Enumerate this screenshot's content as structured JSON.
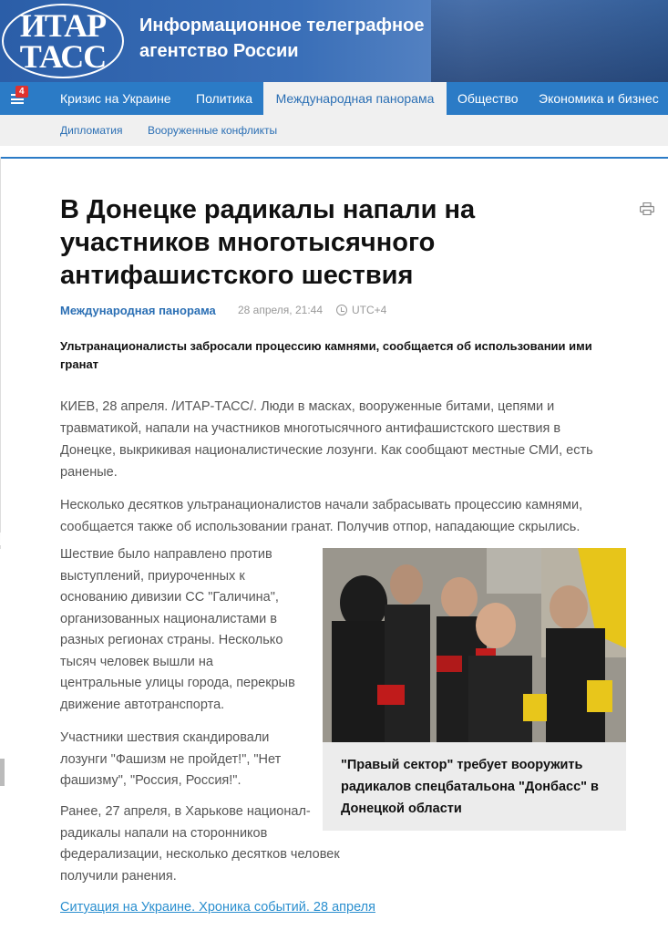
{
  "header": {
    "logo_line1": "ИТАР",
    "logo_line2": "ТАСС",
    "agency_line1": "Информационное телеграфное",
    "agency_line2": "агентство России"
  },
  "nav": {
    "badge": "4",
    "items": [
      {
        "label": "Кризис на Украине"
      },
      {
        "label": "Политика"
      },
      {
        "label": "Международная панорама"
      },
      {
        "label": "Общество"
      },
      {
        "label": "Экономика и бизнес"
      }
    ],
    "sub_items": [
      {
        "label": "Дипломатия"
      },
      {
        "label": "Вооруженные конфликты"
      }
    ]
  },
  "article": {
    "title": "В Донецке радикалы напали на участников многотысячного антифашистского шествия",
    "section": "Международная панорама",
    "date": "28 апреля, 21:44",
    "timezone": "UTC+4",
    "lead": "Ультранационалисты забросали процессию камнями, сообщается об использовании ими гранат",
    "paragraphs": [
      "КИЕВ, 28 апреля. /ИТАР-ТАСС/. Люди в масках, вооруженные битами, цепями и травматикой, напали на участников многотысячного антифашистского шествия в Донецке, выкрикивая националистические лозунги. Как сообщают местные СМИ, есть раненые.",
      "Несколько десятков ультранационалистов начали забрасывать процессию камнями, сообщается также об использовании гранат. Получив отпор, нападающие скрылись.",
      "Шествие было направлено против выступлений, приуроченных к основанию дивизии СС \"Галичина\", организованных националистами в разных регионах страны. Несколько тысяч человек вышли на центральные улицы города, перекрыв движение автотранспорта.",
      "Участники шествия скандировали лозунги \"Фашизм не пройдет!\", \"Нет фашизму\", \"Россия, Россия!\".",
      "Ранее, 27 апреля, в Харькове национал-радикалы напали на сторонников федерализации, несколько десятков человек получили ранения."
    ],
    "story_link": "Ситуация на Украине. Хроника событий. 28 апреля"
  },
  "related": {
    "caption": "\"Правый сектор\" требует вооружить радикалов спецбатальона \"Донбасс\" в Донецкой области"
  },
  "colors": {
    "header_blue": "#2b5ea8",
    "nav_blue": "#2b7bc6",
    "link_blue": "#2b6fb4",
    "badge_red": "#e0322e"
  }
}
